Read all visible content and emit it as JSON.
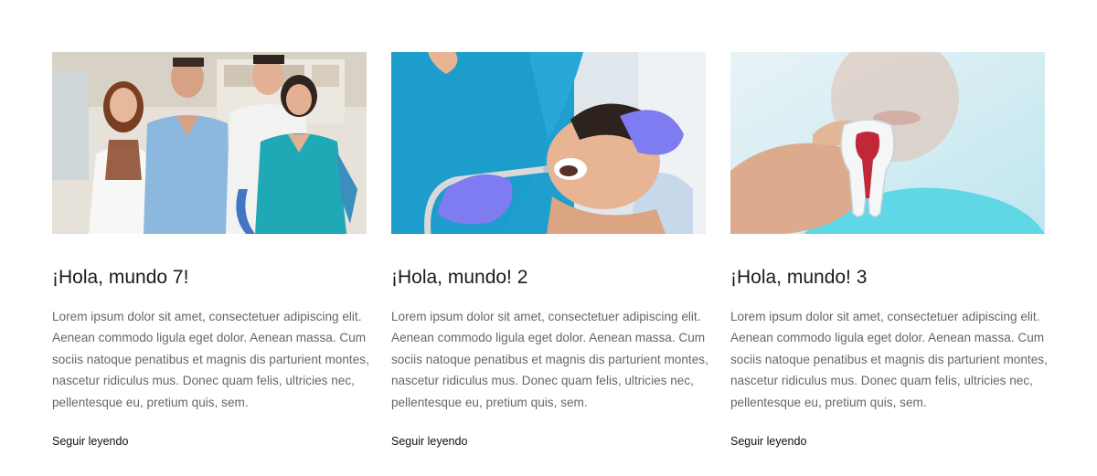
{
  "posts": [
    {
      "title": "¡Hola, mundo 7!",
      "excerpt": "Lorem ipsum dolor sit amet, consectetuer adipiscing elit. Aenean commodo ligula eget dolor. Aenean massa. Cum sociis natoque penatibus et magnis dis parturient montes, nascetur ridiculus mus. Donec quam felis, ultricies nec, pellentesque eu, pretium quis, sem.",
      "read_more": "Seguir leyendo"
    },
    {
      "title": "¡Hola, mundo! 2",
      "excerpt": "Lorem ipsum dolor sit amet, consectetuer adipiscing elit. Aenean commodo ligula eget dolor. Aenean massa. Cum sociis natoque penatibus et magnis dis parturient montes, nascetur ridiculus mus. Donec quam felis, ultricies nec, pellentesque eu, pretium quis, sem.",
      "read_more": "Seguir leyendo"
    },
    {
      "title": "¡Hola, mundo! 3",
      "excerpt": "Lorem ipsum dolor sit amet, consectetuer adipiscing elit. Aenean commodo ligula eget dolor. Aenean massa. Cum sociis natoque penatibus et magnis dis parturient montes, nascetur ridiculus mus. Donec quam felis, ultricies nec, pellentesque eu, pretium quis, sem.",
      "read_more": "Seguir leyendo"
    }
  ],
  "colors": {
    "title": "#1a1a1a",
    "excerpt": "#666666",
    "link": "#111111",
    "scrub_teal": "#1fa8b5",
    "scrub_blue": "#8ab6de",
    "glove": "#7f7bf0"
  }
}
